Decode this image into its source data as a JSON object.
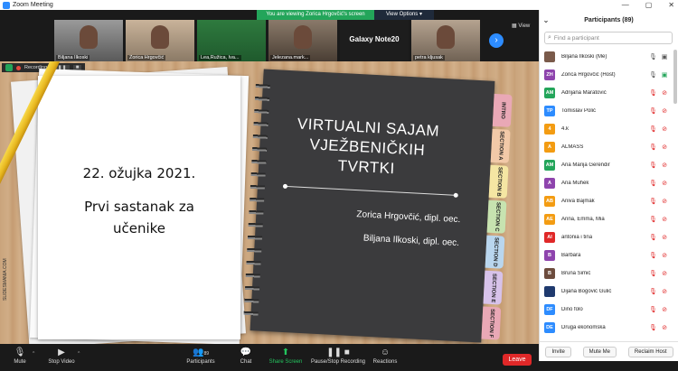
{
  "window": {
    "title": "Zoom Meeting",
    "controls": [
      "—",
      "▢",
      "✕"
    ]
  },
  "banner": {
    "viewing": "You are viewing Zorica Hrgovčić's screen",
    "options": "View Options ▾"
  },
  "gallery": {
    "tiles": [
      {
        "name": "Biljana Ilkoski"
      },
      {
        "name": "Zorica Hrgovčić"
      },
      {
        "name": "Lea,Ružica, Iva..."
      },
      {
        "name": "Jelezana.mark..."
      },
      {
        "name": "Galaxy Note20"
      },
      {
        "name": "petra kljusak"
      }
    ],
    "view_label": "View"
  },
  "recording": {
    "label": "Recording...",
    "pause": "❚❚",
    "stop": "■"
  },
  "slide": {
    "date": "22. ožujka 2021.",
    "subtitle_line1": "Prvi sastanak za",
    "subtitle_line2": "učenike",
    "nb_title_line1": "VIRTUALNI SAJAM",
    "nb_title_line2": "VJEŽBENIČKIH",
    "nb_title_line3": "TVRTKI",
    "author1": "Zorica Hrgovčić, dipl. oec.",
    "author2": "Biljana Ilkoski, dipl. oec.",
    "watermark": "SLIDESMANIA.COM",
    "tabs": [
      {
        "label": "INTRO",
        "color": "#e9a8b6"
      },
      {
        "label": "SECTION A",
        "color": "#f2c9a8"
      },
      {
        "label": "SECTION B",
        "color": "#f5e6a3"
      },
      {
        "label": "SECTION C",
        "color": "#c7e3b0"
      },
      {
        "label": "SECTION D",
        "color": "#b9d6ee"
      },
      {
        "label": "SECTION E",
        "color": "#d7c2ea"
      },
      {
        "label": "SECTION F",
        "color": "#e9a8b6"
      }
    ]
  },
  "controls": {
    "mute": "Mute",
    "stop_video": "Stop Video",
    "participants": "Participants",
    "participants_count": "89",
    "chat": "Chat",
    "share_screen": "Share Screen",
    "pause_recording": "Pause/Stop Recording",
    "reactions": "Reactions",
    "leave": "Leave"
  },
  "panel": {
    "title": "Participants (89)",
    "search_placeholder": "Find a participant",
    "participants": [
      {
        "initials": "",
        "name": "Biljana Ilkoski (Me)",
        "color": "#7a5a4a",
        "mic": "on",
        "cam": "on"
      },
      {
        "initials": "ZH",
        "name": "Zorica Hrgovčić (Host)",
        "color": "#8e44ad",
        "mic": "on",
        "cam": "green"
      },
      {
        "initials": "AM",
        "name": "Adrijana Maratović",
        "color": "#23a55a",
        "mic": "off",
        "cam": "off"
      },
      {
        "initials": "TP",
        "name": "Tomislav Polić",
        "color": "#2d8cff",
        "mic": "off",
        "cam": "off"
      },
      {
        "initials": "4",
        "name": "4.k",
        "color": "#f39c12",
        "mic": "off",
        "cam": "off"
      },
      {
        "initials": "A",
        "name": "ALMASS",
        "color": "#f39c12",
        "mic": "off",
        "cam": "off"
      },
      {
        "initials": "AM",
        "name": "Ana Marija Gerenđir",
        "color": "#23a55a",
        "mic": "off",
        "cam": "off"
      },
      {
        "initials": "A",
        "name": "Ana Muhek",
        "color": "#8e44ad",
        "mic": "off",
        "cam": "off"
      },
      {
        "initials": "AB",
        "name": "Aniva Bajmak",
        "color": "#f39c12",
        "mic": "off",
        "cam": "off"
      },
      {
        "initials": "AE",
        "name": "Anna, Emma, Mia",
        "color": "#f39c12",
        "mic": "off",
        "cam": "off"
      },
      {
        "initials": "AI",
        "name": "antonia i tina",
        "color": "#e02828",
        "mic": "off",
        "cam": "off"
      },
      {
        "initials": "B",
        "name": "Barbara",
        "color": "#8e44ad",
        "mic": "off",
        "cam": "off"
      },
      {
        "initials": "B",
        "name": "Bruna Šimić",
        "color": "#6d4c3d",
        "mic": "off",
        "cam": "off"
      },
      {
        "initials": "",
        "name": "Dijana Bogović Gulić",
        "color": "#1f3a6e",
        "mic": "off",
        "cam": "off"
      },
      {
        "initials": "DF",
        "name": "Dino folo",
        "color": "#2d8cff",
        "mic": "off",
        "cam": "off"
      },
      {
        "initials": "DE",
        "name": "Druga ekonomska",
        "color": "#2d8cff",
        "mic": "off",
        "cam": "off"
      }
    ],
    "invite": "Invite",
    "mute_me": "Mute Me",
    "reclaim_host": "Reclaim Host"
  }
}
